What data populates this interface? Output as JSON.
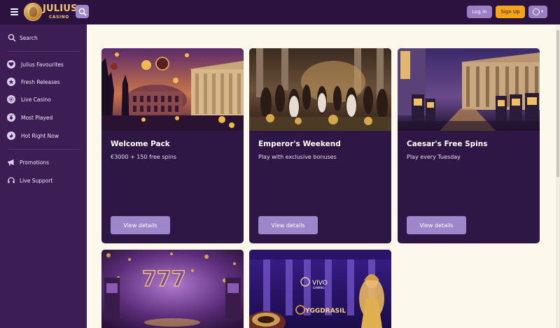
{
  "brand": {
    "name": "JULIUS",
    "sub": "CASINO"
  },
  "header": {
    "login_label": "Log In",
    "signup_label": "Sign Up"
  },
  "sidebar": {
    "search_label": "Search",
    "items": [
      {
        "label": "Julius Favourites",
        "icon": "heart-icon"
      },
      {
        "label": "Fresh Releases",
        "icon": "star-icon"
      },
      {
        "label": "Live Casino",
        "icon": "chip-icon"
      },
      {
        "label": "Most Played",
        "icon": "medal-icon"
      },
      {
        "label": "Hot Right Now",
        "icon": "flame-icon"
      }
    ],
    "support": [
      {
        "label": "Promotions",
        "icon": "megaphone-icon"
      },
      {
        "label": "Live Support",
        "icon": "headset-icon"
      }
    ]
  },
  "promotions": [
    {
      "title": "Welcome Pack",
      "subtitle": "€3000 + 150 free spins",
      "button": "View details"
    },
    {
      "title": "Emperor's Weekend",
      "subtitle": "Play with exclusive bonuses",
      "button": "View details"
    },
    {
      "title": "Caesar's Free Spins",
      "subtitle": "Play every Tuesday",
      "button": "View details"
    }
  ],
  "lower_cards": [
    {
      "image_text": "777"
    },
    {
      "image_text": "VIVO",
      "image_text2": "GAMING",
      "image_text3": "YGGDRASIL"
    }
  ],
  "colors": {
    "topbar": "#2c123e",
    "sidebar": "#3c1e55",
    "content_bg": "#fcf8ec",
    "card": "#2f1745",
    "button": "#9d86c9",
    "signup": "#f3a516",
    "gold": "#f1c76b"
  }
}
